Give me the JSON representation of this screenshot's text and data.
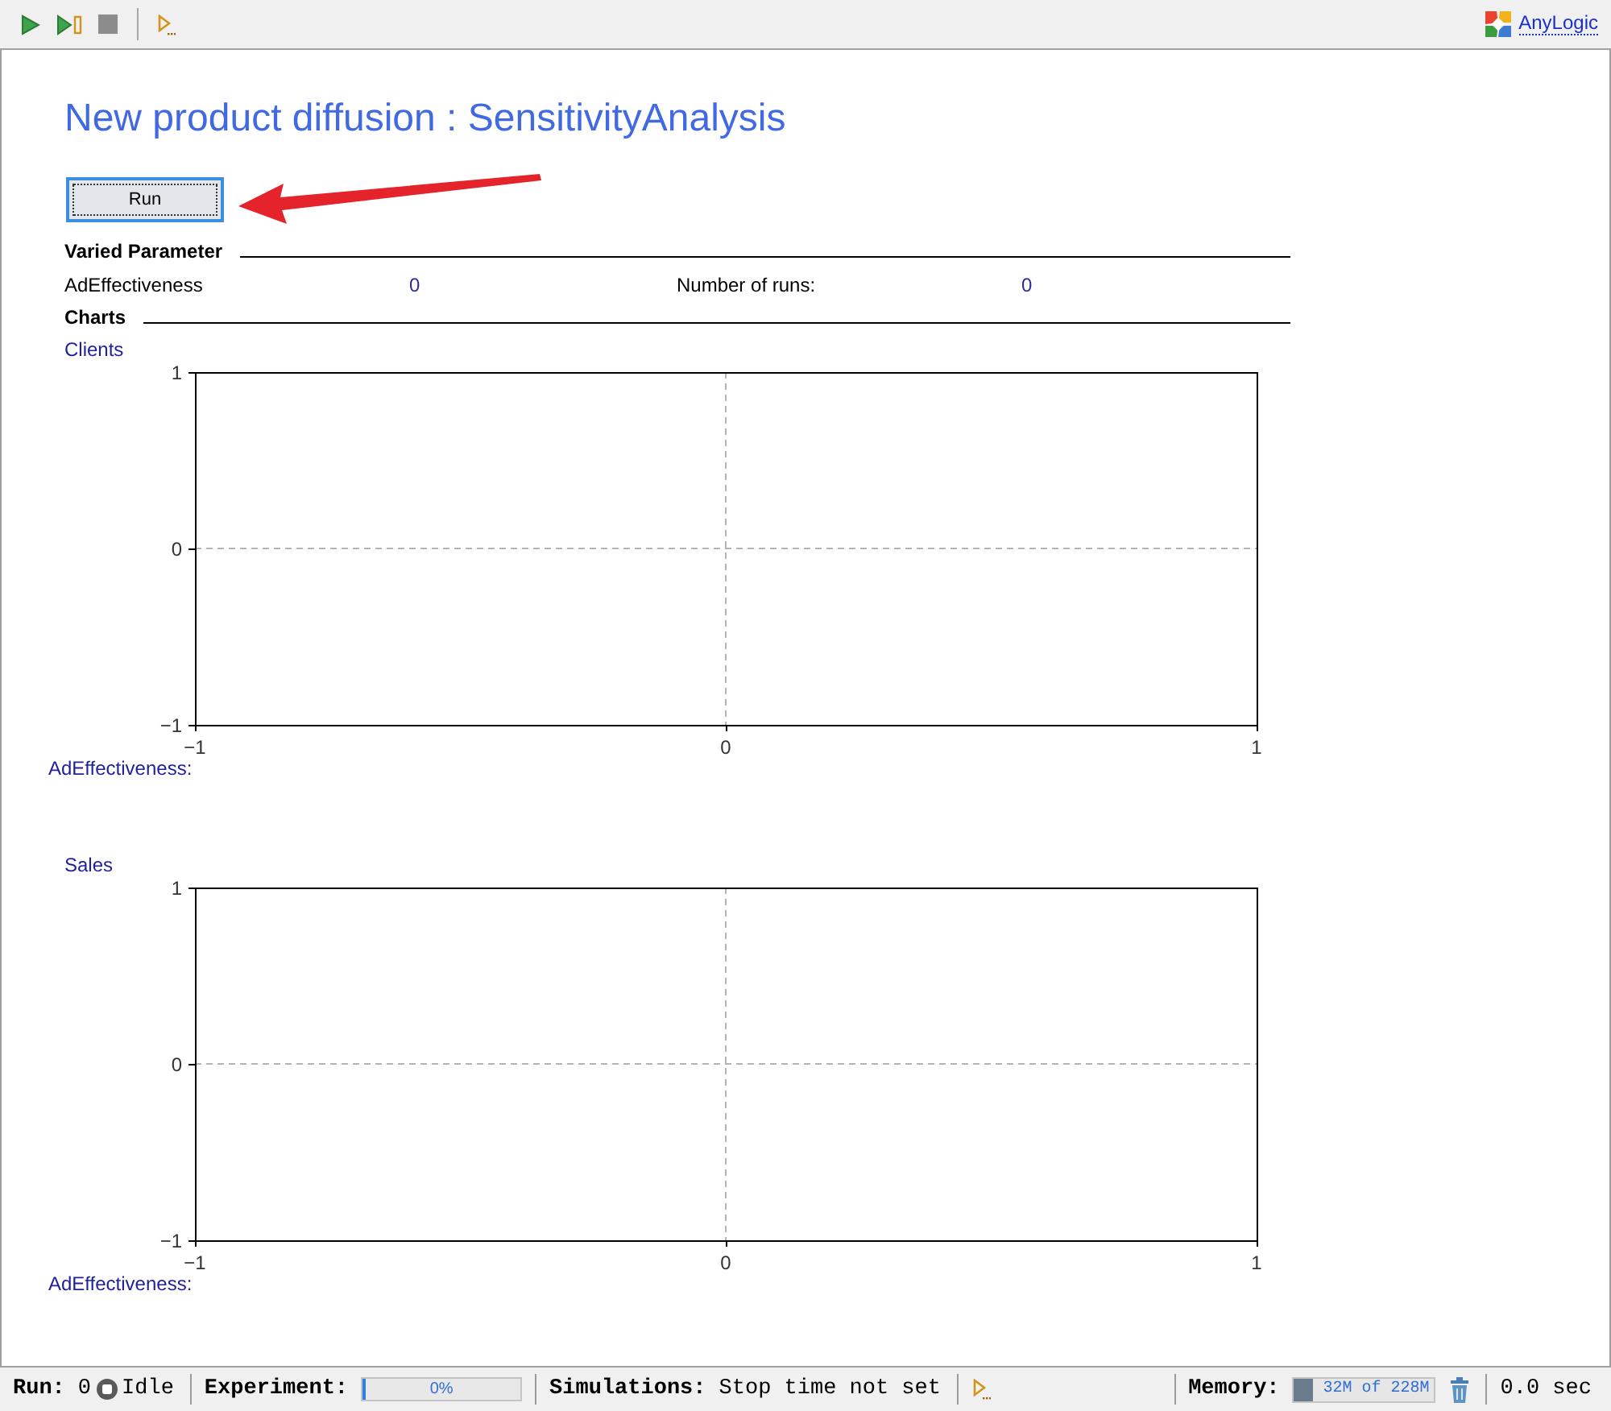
{
  "toolbar": {
    "groups": [
      {
        "buttons": [
          {
            "kind": "play"
          },
          {
            "kind": "step"
          },
          {
            "kind": "stop"
          }
        ]
      },
      {
        "buttons": [
          {
            "kind": "play-menu"
          }
        ]
      }
    ],
    "logo_link": "AnyLogic"
  },
  "page": {
    "title": "New product diffusion : SensitivityAnalysis",
    "run_button": {
      "label": "Run",
      "focused": true
    },
    "varied_parameter": {
      "heading": "Varied Parameter",
      "fields": [
        {
          "label": "AdEffectiveness",
          "value": "0"
        },
        {
          "label": "Number of runs:",
          "value": "0"
        }
      ]
    },
    "charts": {
      "heading": "Charts",
      "items": [
        {
          "chart_data": {
            "type": "line",
            "title": "Clients",
            "xlabel": "AdEffectiveness:",
            "xlim": [
              -1,
              1
            ],
            "ylim": [
              -1,
              1
            ],
            "xticks": [
              {
                "value": -1,
                "label": "−1"
              },
              {
                "value": 0,
                "label": "0"
              },
              {
                "value": 1,
                "label": "1"
              }
            ],
            "yticks": [
              {
                "value": -1,
                "label": "−1"
              },
              {
                "value": 0,
                "label": "0"
              },
              {
                "value": 1,
                "label": "1"
              }
            ]
          }
        },
        {
          "chart_data": {
            "type": "line",
            "title": "Sales",
            "xlabel": "AdEffectiveness:",
            "xlim": [
              -1,
              1
            ],
            "ylim": [
              -1,
              1
            ],
            "xticks": [
              {
                "value": -1,
                "label": "−1"
              },
              {
                "value": 0,
                "label": "0"
              },
              {
                "value": 1,
                "label": "1"
              }
            ],
            "yticks": [
              {
                "value": -1,
                "label": "−1"
              },
              {
                "value": 0,
                "label": "0"
              },
              {
                "value": 1,
                "label": "1"
              }
            ]
          }
        }
      ]
    }
  },
  "status_bar": {
    "run": {
      "label": "Run:",
      "value": "0",
      "state": "Idle"
    },
    "experiment": {
      "label": "Experiment:",
      "level": 0,
      "text": "0%"
    },
    "simulations": {
      "label": "Simulations:",
      "value": "Stop time not set"
    },
    "memory": {
      "label": "Memory:",
      "level": 0.14,
      "text": "32M of 228M"
    },
    "elapsed": "0.0 sec"
  }
}
